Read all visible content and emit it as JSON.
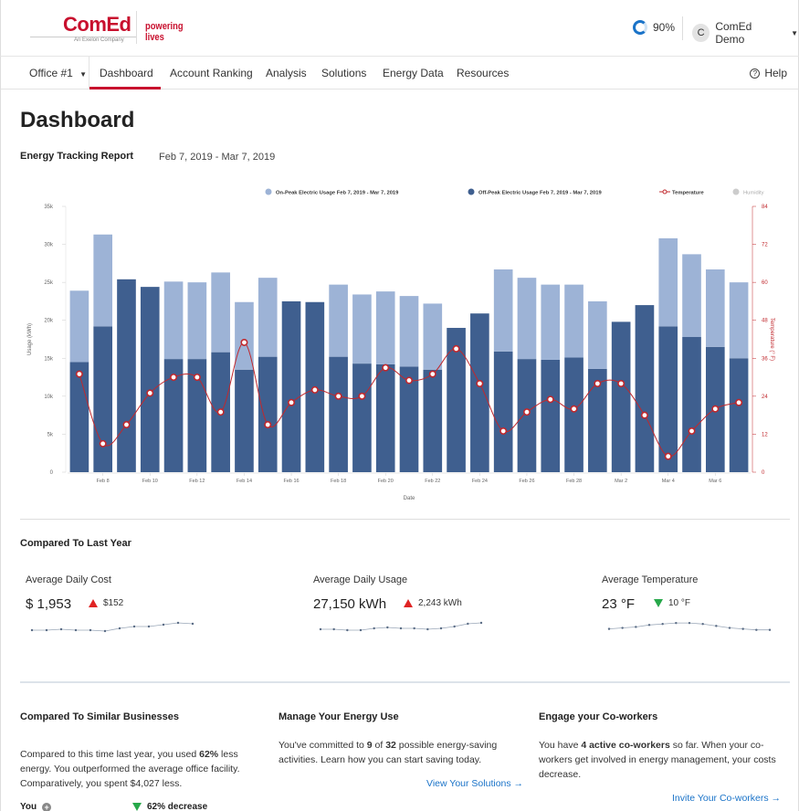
{
  "header": {
    "brand": "ComEd",
    "brand_sub": "An Exelon Company",
    "tagline": "powering lives",
    "progress_label": "90%",
    "progress_value": 0.9,
    "user_initial": "C",
    "user_name": "ComEd Demo"
  },
  "nav": {
    "office": "Office #1",
    "items": [
      "Dashboard",
      "Account Ranking",
      "Analysis",
      "Solutions",
      "Energy Data",
      "Resources"
    ],
    "active": "Dashboard",
    "help": "Help"
  },
  "page_title": "Dashboard",
  "report": {
    "title": "Energy Tracking Report",
    "range": "Feb 7, 2019 - Mar 7, 2019"
  },
  "chart_data": {
    "type": "bar",
    "xlabel": "Date",
    "ylabel": "Usage (kWh)",
    "y2label": "Temperature (° F)",
    "ylim": [
      0,
      35000
    ],
    "y2lim": [
      0,
      84
    ],
    "yticks": [
      "0",
      "5k",
      "10k",
      "15k",
      "20k",
      "25k",
      "30k",
      "35k"
    ],
    "y2ticks": [
      "0",
      "12",
      "24",
      "36",
      "48",
      "60",
      "72",
      "84"
    ],
    "xticks": [
      "Feb 8",
      "Feb 10",
      "Feb 12",
      "Feb 14",
      "Feb 16",
      "Feb 18",
      "Feb 20",
      "Feb 22",
      "Feb 24",
      "Feb 26",
      "Feb 28",
      "Mar 2",
      "Mar 4",
      "Mar 6"
    ],
    "legend": [
      "On-Peak Electric Usage Feb 7, 2019 - Mar 7, 2019",
      "Off-Peak Electric Usage Feb 7, 2019 - Mar 7, 2019",
      "Temperature",
      "Humidity"
    ],
    "legend_position": "top-right",
    "colors": {
      "on_peak": "#9db3d6",
      "off_peak": "#3f5f8f",
      "temperature": "#c0282d",
      "humidity": "#cccccc"
    },
    "series": [
      {
        "name": "Off-Peak Electric Usage Feb 7, 2019 - Mar 7, 2019",
        "values": [
          14500,
          19200,
          25400,
          24400,
          14900,
          14900,
          15800,
          13500,
          15200,
          22500,
          22400,
          15200,
          14300,
          14200,
          13900,
          13500,
          19000,
          20900,
          15900,
          14900,
          14800,
          15100,
          13600,
          19800,
          22000,
          19200,
          17800,
          16500,
          15000
        ]
      },
      {
        "name": "On-Peak Electric Usage Feb 7, 2019 - Mar 7, 2019",
        "values": [
          9400,
          12100,
          0,
          0,
          10200,
          10100,
          10500,
          8900,
          10400,
          0,
          0,
          9500,
          9100,
          9600,
          9300,
          8700,
          0,
          0,
          10800,
          10700,
          9900,
          9600,
          8900,
          0,
          0,
          11600,
          10900,
          10200,
          10000
        ]
      },
      {
        "name": "Temperature",
        "values": [
          31,
          9,
          15,
          25,
          30,
          30,
          19,
          41,
          15,
          22,
          26,
          24,
          24,
          33,
          29,
          31,
          39,
          28,
          13,
          19,
          23,
          20,
          28,
          28,
          18,
          5,
          13,
          20,
          22
        ]
      }
    ]
  },
  "compared_last_year": {
    "title": "Compared To Last Year",
    "metrics": [
      {
        "label": "Average Daily Cost",
        "value": "$ 1,953",
        "delta": "$152",
        "direction": "up",
        "spark": [
          4,
          4,
          5,
          4,
          4,
          3,
          6,
          8,
          8,
          10,
          12,
          11
        ]
      },
      {
        "label": "Average Daily Usage",
        "value": "27,150 kWh",
        "delta": "2,243 kWh",
        "direction": "up",
        "spark": [
          5,
          5,
          4,
          4,
          6,
          7,
          6,
          6,
          5,
          6,
          8,
          11,
          12
        ]
      },
      {
        "label": "Average Temperature",
        "value": "23 °F",
        "delta": "10 °F",
        "direction": "down",
        "spark": [
          5,
          6,
          7,
          9,
          10,
          11,
          11,
          10,
          8,
          6,
          5,
          4,
          4
        ]
      }
    ]
  },
  "similar_businesses": {
    "title": "Compared To Similar Businesses",
    "text_pre": "Compared to this time last year, you used ",
    "text_bold": "62%",
    "text_post": " less energy. You outperformed the average office facility. Comparatively, you spent $4,027 less.",
    "you_label": "You",
    "decrease_label": "62% decrease"
  },
  "manage_energy": {
    "title": "Manage Your Energy Use",
    "text_1": "You've committed to ",
    "num_1": "9",
    "text_2": " of ",
    "num_2": "32",
    "text_3": " possible energy-saving activities. Learn how you can start saving today.",
    "link": "View Your Solutions →"
  },
  "coworkers": {
    "title": "Engage your Co-workers",
    "text_1": "You have ",
    "bold": "4 active co-workers",
    "text_2": " so far. When your co-workers get involved in energy management, your costs decrease.",
    "link": "Invite Your Co-workers →"
  }
}
